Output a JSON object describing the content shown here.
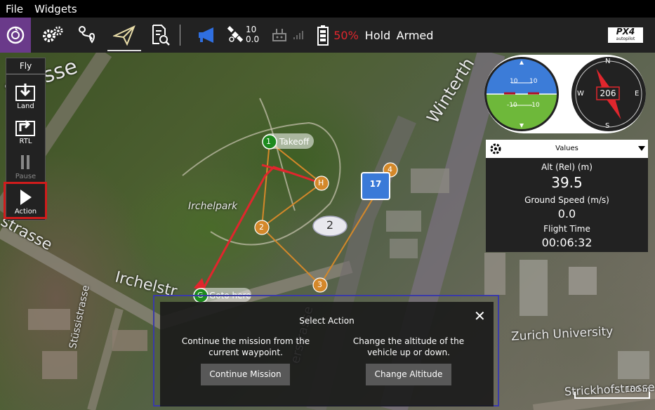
{
  "menu": {
    "file": "File",
    "widgets": "Widgets"
  },
  "toolbar": {
    "gps_count": "10",
    "gps_hdop": "0.0",
    "battery": "50%",
    "flight_mode": "Hold",
    "arm_state": "Armed",
    "brand": "PX4",
    "brand_sub": "autopilot",
    "battery_color": "#e0262d"
  },
  "fly_toolbar": {
    "title": "Fly",
    "items": [
      {
        "label": "Land",
        "icon": "land-icon"
      },
      {
        "label": "RTL",
        "icon": "rtl-icon"
      },
      {
        "label": "Pause",
        "icon": "pause-icon"
      },
      {
        "label": "Action",
        "icon": "play-icon"
      }
    ]
  },
  "map": {
    "labels": [
      "strasse",
      "Winterth",
      "Irchelpark",
      "strasse",
      "Irchelstr",
      "Stüssistrasse",
      "Zurich University",
      "Strickhofstrasse",
      "erstrasse"
    ],
    "waypoints": [
      {
        "label": "1",
        "tag": "Takeoff"
      },
      {
        "label": "H"
      },
      {
        "label": "2"
      },
      {
        "label": "3"
      },
      {
        "label": "4"
      }
    ],
    "goto": {
      "label": "G",
      "tag": "Goto here"
    },
    "sign": "17",
    "badge": "2",
    "scale": "100 m"
  },
  "instruments": {
    "attitude_marks": [
      "10",
      "10",
      "-10",
      "-10"
    ],
    "compass": {
      "heading": "206",
      "n": "N",
      "e": "E",
      "s": "S",
      "w": "W"
    }
  },
  "values": {
    "header": "Values",
    "alt_label": "Alt (Rel) (m)",
    "alt_value": "39.5",
    "speed_label": "Ground Speed (m/s)",
    "speed_value": "0.0",
    "time_label": "Flight Time",
    "time_value": "00:06:32"
  },
  "dialog": {
    "title": "Select Action",
    "left_desc": "Continue the mission from the current waypoint.",
    "right_desc": "Change the altitude of the vehicle up or down.",
    "continue_btn": "Continue Mission",
    "altitude_btn": "Change Altitude"
  },
  "colors": {
    "accent": "#6a3a8a",
    "waypoint": "#d4882a",
    "takeoff": "#1d8a1d",
    "flight_path": "#e0262d",
    "highlight": "#d01c1c",
    "dialog_outline": "#3a3aa8"
  }
}
